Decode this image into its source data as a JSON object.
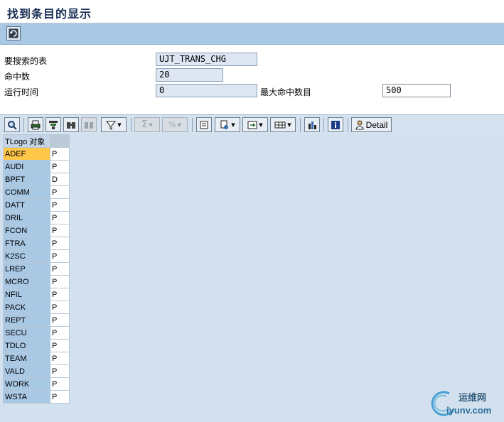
{
  "window": {
    "title": "找到条目的显示"
  },
  "appbar": {
    "refresh_icon": "refresh-icon"
  },
  "form": {
    "table_label": "要搜索的表",
    "table_value": "UJT_TRANS_CHG",
    "hits_label": "命中数",
    "hits_value": "20",
    "runtime_label": "运行时间",
    "runtime_value": "0",
    "max_hits_label": "最大命中数目",
    "max_hits_value": "500"
  },
  "toolbar": {
    "detail_label": "Detail",
    "buttons": [
      "details-icon",
      "print-icon",
      "filter-total-icon",
      "find-icon",
      "find-next-icon",
      "filter-icon",
      "sum-icon",
      "subtotal-icon",
      "print-preview-icon",
      "export-icon",
      "local-file-icon",
      "layout-icon",
      "graphic-icon",
      "info-icon",
      "detail-icon"
    ]
  },
  "grid": {
    "header": "TLogo 对象",
    "rows": [
      {
        "key": "ADEF",
        "val": "P"
      },
      {
        "key": "AUDI",
        "val": "P"
      },
      {
        "key": "BPFT",
        "val": "D"
      },
      {
        "key": "COMM",
        "val": "P"
      },
      {
        "key": "DATT",
        "val": "P"
      },
      {
        "key": "DRIL",
        "val": "P"
      },
      {
        "key": "FCON",
        "val": "P"
      },
      {
        "key": "FTRA",
        "val": "P"
      },
      {
        "key": "K2SC",
        "val": "P"
      },
      {
        "key": "LREP",
        "val": "P"
      },
      {
        "key": "MCRO",
        "val": "P"
      },
      {
        "key": "NFIL",
        "val": "P"
      },
      {
        "key": "PACK",
        "val": "P"
      },
      {
        "key": "REPT",
        "val": "P"
      },
      {
        "key": "SECU",
        "val": "P"
      },
      {
        "key": "TDLO",
        "val": "P"
      },
      {
        "key": "TEAM",
        "val": "P"
      },
      {
        "key": "VALD",
        "val": "P"
      },
      {
        "key": "WORK",
        "val": "P"
      },
      {
        "key": "WSTA",
        "val": "P"
      }
    ]
  },
  "watermark": {
    "top": "运维网",
    "bottom": "iyunv.com"
  }
}
